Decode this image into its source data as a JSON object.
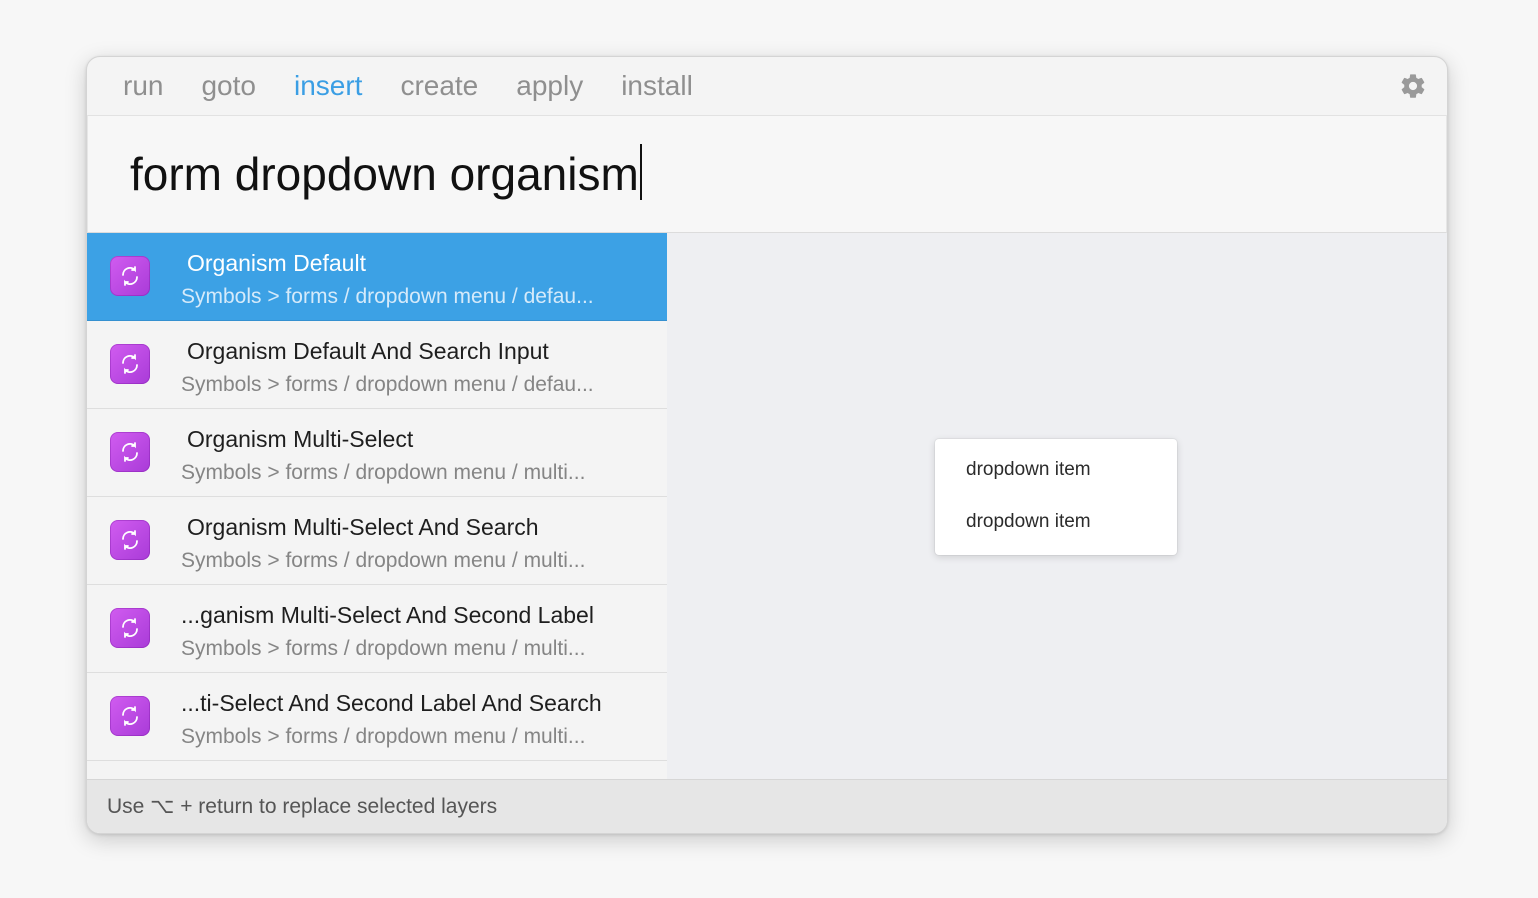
{
  "tabs": [
    {
      "label": "run"
    },
    {
      "label": "goto"
    },
    {
      "label": "insert"
    },
    {
      "label": "create"
    },
    {
      "label": "apply"
    },
    {
      "label": "install"
    }
  ],
  "active_tab": "insert",
  "search": {
    "value": "form dropdown organism"
  },
  "results": [
    {
      "title": "Organism Default",
      "subtitle": "Symbols > forms / dropdown menu / defau..."
    },
    {
      "title": "Organism Default And Search Input",
      "subtitle": "Symbols > forms / dropdown menu / defau..."
    },
    {
      "title": "Organism Multi-Select",
      "subtitle": "Symbols > forms / dropdown menu / multi..."
    },
    {
      "title": "Organism Multi-Select And Search",
      "subtitle": "Symbols > forms / dropdown menu / multi..."
    },
    {
      "title": "...ganism Multi-Select And Second Label",
      "subtitle": "Symbols > forms / dropdown menu / multi..."
    },
    {
      "title": "...ti-Select And Second Label And Search",
      "subtitle": "Symbols > forms / dropdown menu / multi..."
    }
  ],
  "result_icon": "symbol-sync-icon",
  "preview": {
    "items": [
      "dropdown item",
      "dropdown item"
    ]
  },
  "footer": {
    "hint": "Use ⌥ + return to replace selected layers"
  },
  "colors": {
    "accent": "#3a9ee4",
    "selection": "#3ca1e5",
    "icon_purple": "#c04ee6"
  }
}
